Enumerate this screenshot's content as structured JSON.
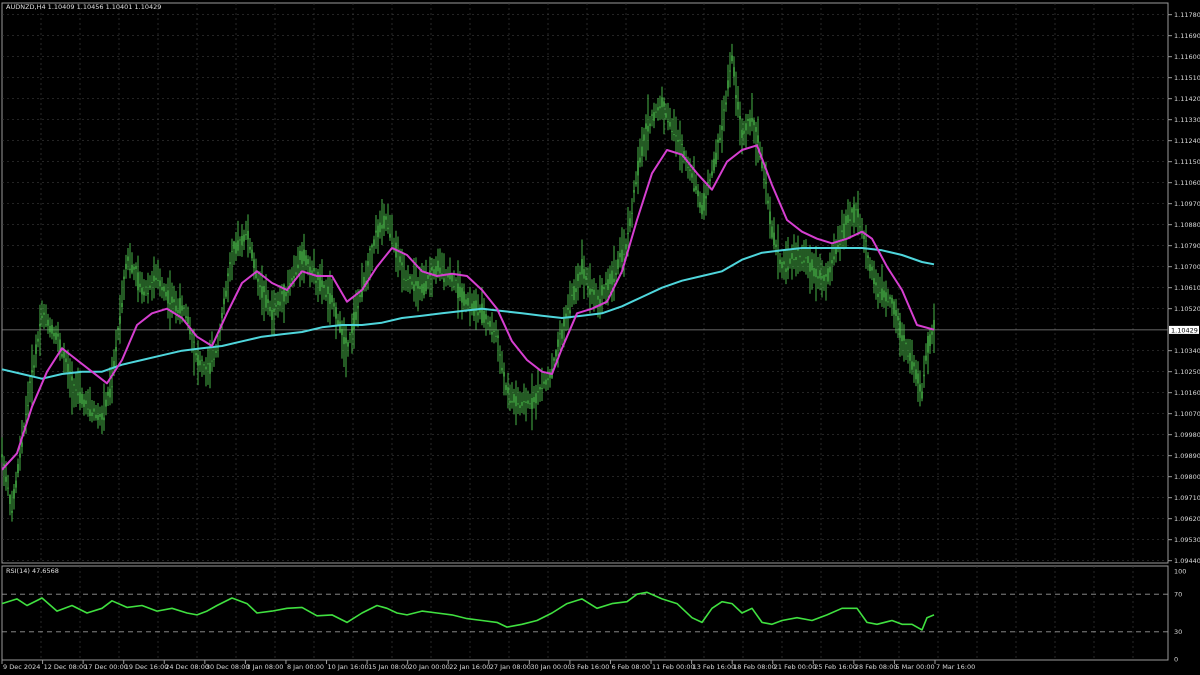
{
  "header": {
    "symbol_line": "AUDNZD,H4  1.10409 1.10456 1.10401 1.10429",
    "rsi_line": "RSI(14) 47.6568"
  },
  "colors": {
    "background": "#000000",
    "grid": "#3a3a3a",
    "candles": "#4fc84f",
    "fast_ma": "#d63fd0",
    "slow_ma": "#4fd6dc",
    "rsi": "#40e040",
    "axis_text": "#d8d8d8",
    "price_tag_bg": "#ffffff",
    "price_tag_text": "#000000"
  },
  "chart_data": [
    {
      "type": "line",
      "title": "AUDNZD,H4",
      "y_ticks": [
        "1.11780",
        "1.11690",
        "1.11600",
        "1.11510",
        "1.11420",
        "1.11330",
        "1.11240",
        "1.11150",
        "1.11060",
        "1.10970",
        "1.10880",
        "1.10790",
        "1.10700",
        "1.10610",
        "1.10520",
        "1.10340",
        "1.10250",
        "1.10160",
        "1.10070",
        "1.09980",
        "1.09890",
        "1.09800",
        "1.09710",
        "1.09620",
        "1.09530",
        "1.09440"
      ],
      "current_price": "1.10429",
      "ylim": [
        1.0943,
        1.1183
      ],
      "x_ticks": [
        "9 Dec 2024",
        "12 Dec 08:00",
        "17 Dec 00:00",
        "19 Dec 16:00",
        "24 Dec 08:00",
        "30 Dec 08:00",
        "3 Jan 08:00",
        "8 Jan 00:00",
        "10 Jan 16:00",
        "15 Jan 08:00",
        "20 Jan 00:00",
        "22 Jan 16:00",
        "27 Jan 08:00",
        "30 Jan 00:00",
        "3 Feb 16:00",
        "6 Feb 08:00",
        "11 Feb 00:00",
        "13 Feb 16:00",
        "18 Feb 08:00",
        "21 Feb 00:00",
        "25 Feb 16:00",
        "28 Feb 08:00",
        "5 Mar 00:00",
        "7 Mar 16:00"
      ],
      "series": [
        {
          "key": "price",
          "points": [
            [
              0,
              1.099
            ],
            [
              10,
              1.0965
            ],
            [
              25,
              1.101
            ],
            [
              40,
              1.105
            ],
            [
              55,
              1.104
            ],
            [
              70,
              1.102
            ],
            [
              85,
              1.101
            ],
            [
              100,
              1.1005
            ],
            [
              110,
              1.102
            ],
            [
              125,
              1.1075
            ],
            [
              140,
              1.106
            ],
            [
              155,
              1.1065
            ],
            [
              170,
              1.1055
            ],
            [
              185,
              1.105
            ],
            [
              195,
              1.103
            ],
            [
              205,
              1.1025
            ],
            [
              215,
              1.1035
            ],
            [
              230,
              1.1075
            ],
            [
              245,
              1.1085
            ],
            [
              255,
              1.1065
            ],
            [
              270,
              1.105
            ],
            [
              285,
              1.106
            ],
            [
              300,
              1.1075
            ],
            [
              315,
              1.1065
            ],
            [
              330,
              1.1055
            ],
            [
              345,
              1.1035
            ],
            [
              360,
              1.106
            ],
            [
              375,
              1.1085
            ],
            [
              385,
              1.109
            ],
            [
              395,
              1.1075
            ],
            [
              405,
              1.1065
            ],
            [
              420,
              1.106
            ],
            [
              435,
              1.107
            ],
            [
              450,
              1.1065
            ],
            [
              465,
              1.1055
            ],
            [
              480,
              1.105
            ],
            [
              495,
              1.104
            ],
            [
              505,
              1.1015
            ],
            [
              520,
              1.101
            ],
            [
              535,
              1.1015
            ],
            [
              550,
              1.1025
            ],
            [
              565,
              1.105
            ],
            [
              580,
              1.107
            ],
            [
              595,
              1.1055
            ],
            [
              610,
              1.1065
            ],
            [
              625,
              1.108
            ],
            [
              635,
              1.111
            ],
            [
              645,
              1.113
            ],
            [
              660,
              1.114
            ],
            [
              675,
              1.1125
            ],
            [
              690,
              1.111
            ],
            [
              700,
              1.1095
            ],
            [
              710,
              1.111
            ],
            [
              720,
              1.113
            ],
            [
              730,
              1.116
            ],
            [
              740,
              1.1125
            ],
            [
              750,
              1.1135
            ],
            [
              760,
              1.1115
            ],
            [
              770,
              1.1085
            ],
            [
              780,
              1.107
            ],
            [
              795,
              1.1075
            ],
            [
              810,
              1.107
            ],
            [
              825,
              1.1065
            ],
            [
              840,
              1.1085
            ],
            [
              855,
              1.1095
            ],
            [
              865,
              1.1075
            ],
            [
              875,
              1.106
            ],
            [
              890,
              1.1055
            ],
            [
              900,
              1.104
            ],
            [
              910,
              1.103
            ],
            [
              920,
              1.1015
            ],
            [
              925,
              1.1035
            ],
            [
              932,
              1.1043
            ]
          ]
        },
        {
          "key": "fast_ma",
          "points": [
            [
              0,
              1.0983
            ],
            [
              15,
              1.099
            ],
            [
              30,
              1.101
            ],
            [
              45,
              1.1025
            ],
            [
              60,
              1.1035
            ],
            [
              75,
              1.103
            ],
            [
              90,
              1.1025
            ],
            [
              105,
              1.102
            ],
            [
              120,
              1.103
            ],
            [
              135,
              1.1045
            ],
            [
              150,
              1.105
            ],
            [
              165,
              1.1052
            ],
            [
              180,
              1.1048
            ],
            [
              195,
              1.104
            ],
            [
              210,
              1.1036
            ],
            [
              225,
              1.105
            ],
            [
              240,
              1.1063
            ],
            [
              255,
              1.1068
            ],
            [
              270,
              1.1063
            ],
            [
              285,
              1.106
            ],
            [
              300,
              1.1068
            ],
            [
              315,
              1.1066
            ],
            [
              330,
              1.1066
            ],
            [
              345,
              1.1055
            ],
            [
              360,
              1.106
            ],
            [
              375,
              1.107
            ],
            [
              390,
              1.1078
            ],
            [
              405,
              1.1075
            ],
            [
              420,
              1.1068
            ],
            [
              435,
              1.1066
            ],
            [
              450,
              1.1067
            ],
            [
              465,
              1.1066
            ],
            [
              480,
              1.106
            ],
            [
              495,
              1.1052
            ],
            [
              510,
              1.1038
            ],
            [
              525,
              1.103
            ],
            [
              540,
              1.1025
            ],
            [
              550,
              1.1024
            ],
            [
              560,
              1.1035
            ],
            [
              575,
              1.105
            ],
            [
              590,
              1.1052
            ],
            [
              605,
              1.1055
            ],
            [
              620,
              1.1068
            ],
            [
              635,
              1.109
            ],
            [
              650,
              1.111
            ],
            [
              665,
              1.112
            ],
            [
              680,
              1.1118
            ],
            [
              695,
              1.111
            ],
            [
              710,
              1.1103
            ],
            [
              725,
              1.1115
            ],
            [
              740,
              1.112
            ],
            [
              755,
              1.1122
            ],
            [
              770,
              1.1105
            ],
            [
              785,
              1.109
            ],
            [
              800,
              1.1085
            ],
            [
              815,
              1.1082
            ],
            [
              830,
              1.108
            ],
            [
              845,
              1.1082
            ],
            [
              860,
              1.1085
            ],
            [
              870,
              1.1082
            ],
            [
              885,
              1.107
            ],
            [
              900,
              1.106
            ],
            [
              915,
              1.1045
            ],
            [
              932,
              1.1043
            ]
          ]
        },
        {
          "key": "slow_ma",
          "points": [
            [
              0,
              1.1026
            ],
            [
              20,
              1.1024
            ],
            [
              40,
              1.1022
            ],
            [
              60,
              1.1024
            ],
            [
              80,
              1.1025
            ],
            [
              100,
              1.1025
            ],
            [
              120,
              1.1028
            ],
            [
              140,
              1.103
            ],
            [
              160,
              1.1032
            ],
            [
              180,
              1.1034
            ],
            [
              200,
              1.1035
            ],
            [
              220,
              1.1036
            ],
            [
              240,
              1.1038
            ],
            [
              260,
              1.104
            ],
            [
              280,
              1.1041
            ],
            [
              300,
              1.1042
            ],
            [
              320,
              1.1044
            ],
            [
              340,
              1.1045
            ],
            [
              360,
              1.1045
            ],
            [
              380,
              1.1046
            ],
            [
              400,
              1.1048
            ],
            [
              420,
              1.1049
            ],
            [
              440,
              1.105
            ],
            [
              460,
              1.1051
            ],
            [
              480,
              1.1052
            ],
            [
              500,
              1.1051
            ],
            [
              520,
              1.105
            ],
            [
              540,
              1.1049
            ],
            [
              560,
              1.1048
            ],
            [
              580,
              1.1049
            ],
            [
              600,
              1.105
            ],
            [
              620,
              1.1053
            ],
            [
              640,
              1.1057
            ],
            [
              660,
              1.1061
            ],
            [
              680,
              1.1064
            ],
            [
              700,
              1.1066
            ],
            [
              720,
              1.1068
            ],
            [
              740,
              1.1073
            ],
            [
              760,
              1.1076
            ],
            [
              780,
              1.1077
            ],
            [
              800,
              1.1078
            ],
            [
              820,
              1.1078
            ],
            [
              840,
              1.1078
            ],
            [
              860,
              1.1078
            ],
            [
              880,
              1.1077
            ],
            [
              900,
              1.1075
            ],
            [
              920,
              1.1072
            ],
            [
              932,
              1.1071
            ]
          ]
        }
      ]
    },
    {
      "type": "line",
      "title": "RSI(14) 47.6568",
      "ylim": [
        0,
        100
      ],
      "y_ticks": [
        "100",
        "70",
        "30",
        "0"
      ],
      "levels": [
        70,
        30
      ],
      "series": [
        {
          "key": "rsi",
          "points": [
            [
              0,
              60
            ],
            [
              15,
              65
            ],
            [
              25,
              58
            ],
            [
              40,
              66
            ],
            [
              55,
              52
            ],
            [
              70,
              58
            ],
            [
              85,
              50
            ],
            [
              100,
              55
            ],
            [
              110,
              63
            ],
            [
              125,
              56
            ],
            [
              140,
              58
            ],
            [
              155,
              52
            ],
            [
              170,
              55
            ],
            [
              185,
              50
            ],
            [
              195,
              48
            ],
            [
              205,
              52
            ],
            [
              215,
              58
            ],
            [
              230,
              66
            ],
            [
              245,
              60
            ],
            [
              255,
              50
            ],
            [
              270,
              52
            ],
            [
              285,
              55
            ],
            [
              300,
              56
            ],
            [
              315,
              47
            ],
            [
              330,
              48
            ],
            [
              345,
              40
            ],
            [
              360,
              50
            ],
            [
              375,
              58
            ],
            [
              385,
              55
            ],
            [
              395,
              50
            ],
            [
              405,
              48
            ],
            [
              420,
              52
            ],
            [
              435,
              50
            ],
            [
              450,
              48
            ],
            [
              465,
              44
            ],
            [
              480,
              42
            ],
            [
              495,
              40
            ],
            [
              505,
              35
            ],
            [
              520,
              38
            ],
            [
              535,
              42
            ],
            [
              550,
              50
            ],
            [
              565,
              60
            ],
            [
              580,
              65
            ],
            [
              595,
              55
            ],
            [
              610,
              60
            ],
            [
              625,
              62
            ],
            [
              635,
              70
            ],
            [
              645,
              72
            ],
            [
              660,
              65
            ],
            [
              675,
              60
            ],
            [
              690,
              45
            ],
            [
              700,
              40
            ],
            [
              710,
              55
            ],
            [
              720,
              62
            ],
            [
              730,
              60
            ],
            [
              740,
              50
            ],
            [
              750,
              55
            ],
            [
              760,
              40
            ],
            [
              770,
              38
            ],
            [
              780,
              42
            ],
            [
              795,
              45
            ],
            [
              810,
              42
            ],
            [
              825,
              48
            ],
            [
              840,
              55
            ],
            [
              855,
              55
            ],
            [
              865,
              40
            ],
            [
              875,
              38
            ],
            [
              890,
              42
            ],
            [
              900,
              38
            ],
            [
              910,
              38
            ],
            [
              920,
              32
            ],
            [
              925,
              45
            ],
            [
              932,
              48
            ]
          ]
        }
      ]
    }
  ]
}
